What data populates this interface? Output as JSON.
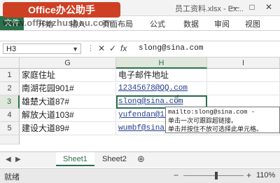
{
  "window": {
    "title": "员工资料.xlsx - Ex...",
    "min_glyph": "—",
    "max_glyph": "□",
    "close_glyph": "✕"
  },
  "watermark": {
    "badge": "Office办公助手",
    "url": "www.officezhushou.com"
  },
  "ribbon": {
    "tabs": [
      "文件",
      "开始",
      "插入",
      "页面布局",
      "公式",
      "数据",
      "审阅",
      "视图"
    ]
  },
  "formula_bar": {
    "name_box": "H3",
    "cancel_icon": "✕",
    "enter_icon": "✓",
    "fx": "fx",
    "value": "slong@sina.com"
  },
  "grid": {
    "columns": [
      {
        "label": "G"
      },
      {
        "label": "H"
      },
      {
        "label": "I"
      }
    ],
    "rows": [
      {
        "num": "1",
        "g": "家庭住址",
        "h": "电子邮件地址"
      },
      {
        "num": "2",
        "g": "南湖花园901#",
        "h": "12345678@QQ.com"
      },
      {
        "num": "3",
        "g": "雄楚大道87#",
        "h": "slong@sina.com"
      },
      {
        "num": "4",
        "g": "解放大道103#",
        "h": "yufendan@1..."
      },
      {
        "num": "5",
        "g": "建设大道89#",
        "h": "wumbf@sina..."
      }
    ],
    "active_cell": "H3"
  },
  "tooltip": {
    "line1": "mailto:slong@sina.com -",
    "line2": "单击一次可跟踪超链接。",
    "line3": "单击并按住不放可选择此单元格。"
  },
  "sheets": {
    "nav_prev": "◀",
    "nav_next": "▶",
    "tabs": [
      "Sheet1",
      "Sheet2"
    ],
    "active": "Sheet1",
    "add": "⊕"
  },
  "status": {
    "text": "就绪",
    "zoom_minus": "−",
    "zoom_plus": "+",
    "zoom": "110%",
    "zoom_fraction": 0.55
  },
  "colors": {
    "excel_green": "#217346",
    "hyperlink": "#1f3f9e",
    "watermark_red": "#e23b1a"
  }
}
